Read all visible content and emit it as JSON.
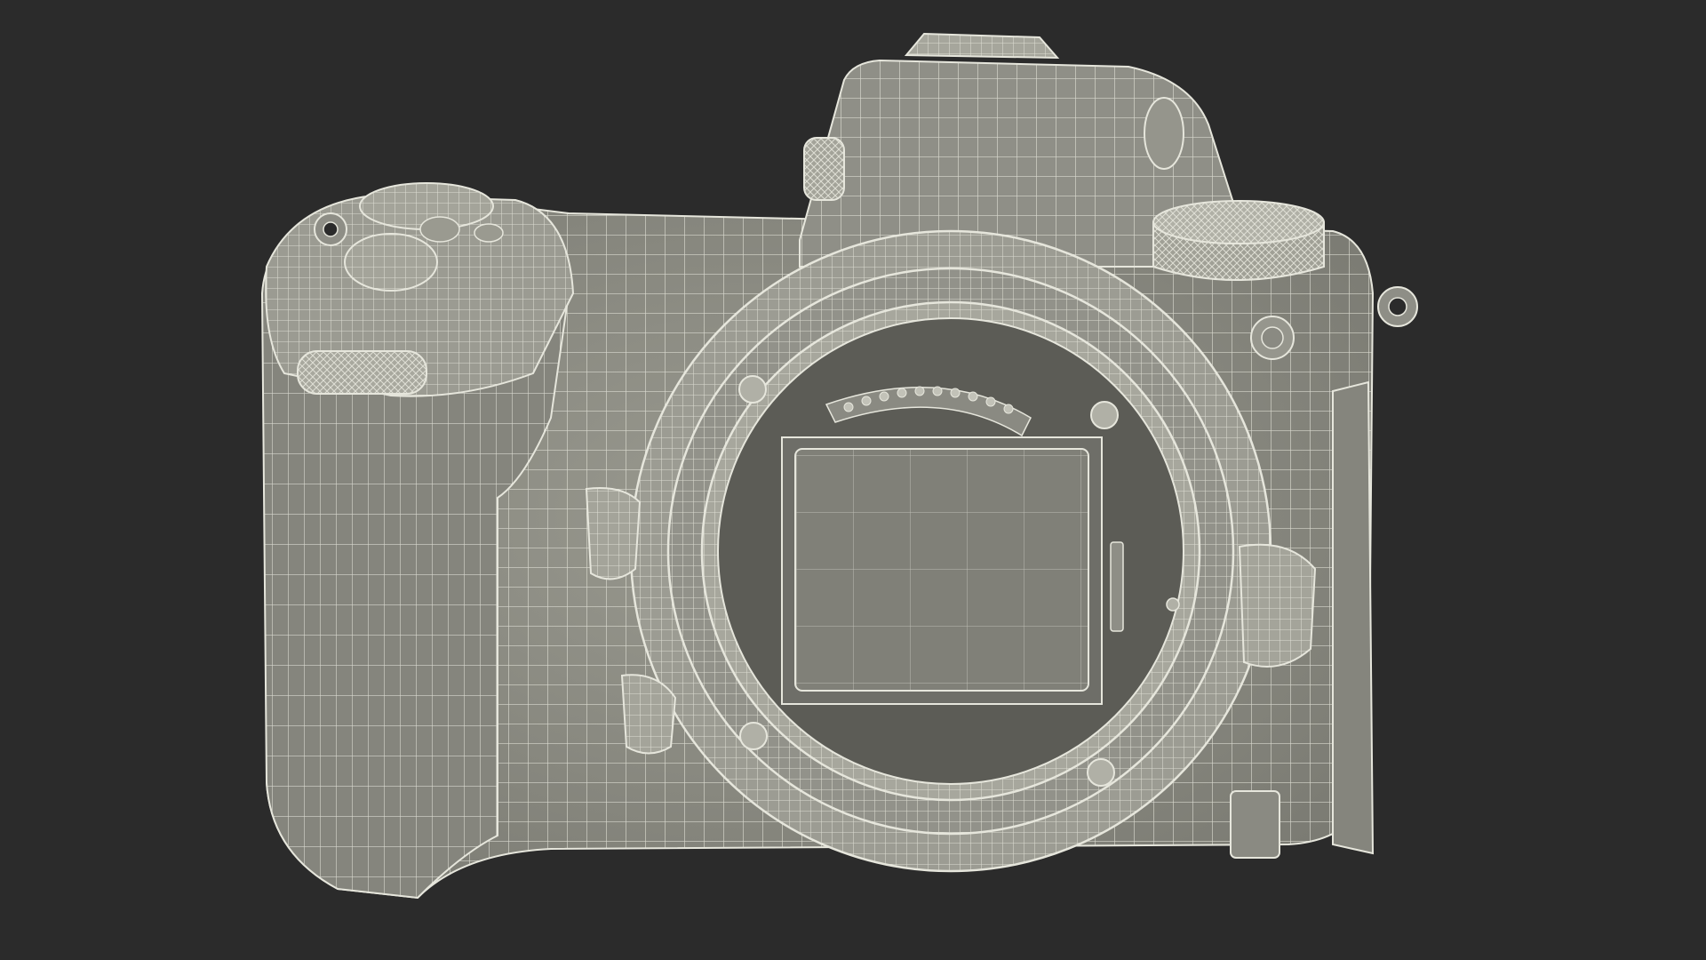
{
  "scene": {
    "subject": "camera-body-wireframe",
    "colors": {
      "background": "#2b2b2b",
      "body_fill": "#8d8d84",
      "body_fill_light": "#a0a096",
      "body_fill_dark": "#6f6f68",
      "wire": "#e6e6dc",
      "sensor": "#7e7e76",
      "cavity": "#5c5c56"
    }
  }
}
